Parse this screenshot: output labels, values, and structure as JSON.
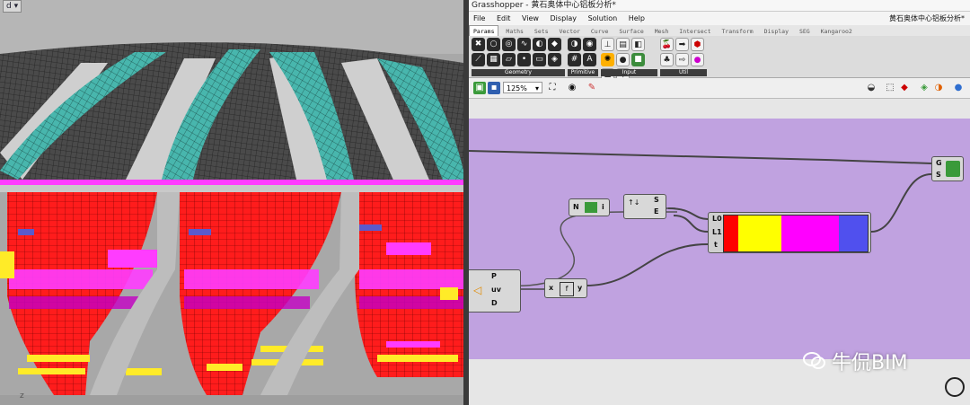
{
  "viewport": {
    "label": "d",
    "axis_glyph": "z"
  },
  "gh": {
    "window_title": "Grasshopper - 黄石奥体中心铝板分析*",
    "menu": [
      "File",
      "Edit",
      "View",
      "Display",
      "Solution",
      "Help"
    ],
    "document_name": "黄石奥体中心铝板分析*",
    "tabs": [
      "Params",
      "Maths",
      "Sets",
      "Vector",
      "Curve",
      "Surface",
      "Mesh",
      "Intersect",
      "Transform",
      "Display",
      "SEG",
      "Kangaroo2"
    ],
    "active_tab": "Params",
    "groups": [
      "Geometry",
      "Primitive",
      "Input",
      "Util"
    ],
    "zoom": "125%",
    "components": {
      "shift_text": "N",
      "shift_right": "i",
      "series_right_s": "S",
      "series_right_e": "E",
      "gradient_inputs": [
        "L0",
        "L1",
        "t"
      ],
      "preview_inputs": [
        "G",
        "S"
      ],
      "surface_inputs": [
        "P",
        "uv",
        "D"
      ],
      "expression_x": "x",
      "expression_y": "y"
    },
    "gradient_colors": [
      "#ff0000",
      "#ffff00",
      "#ff00ff",
      "#5050ee"
    ]
  },
  "watermark": {
    "text": "牛侃BIM"
  }
}
